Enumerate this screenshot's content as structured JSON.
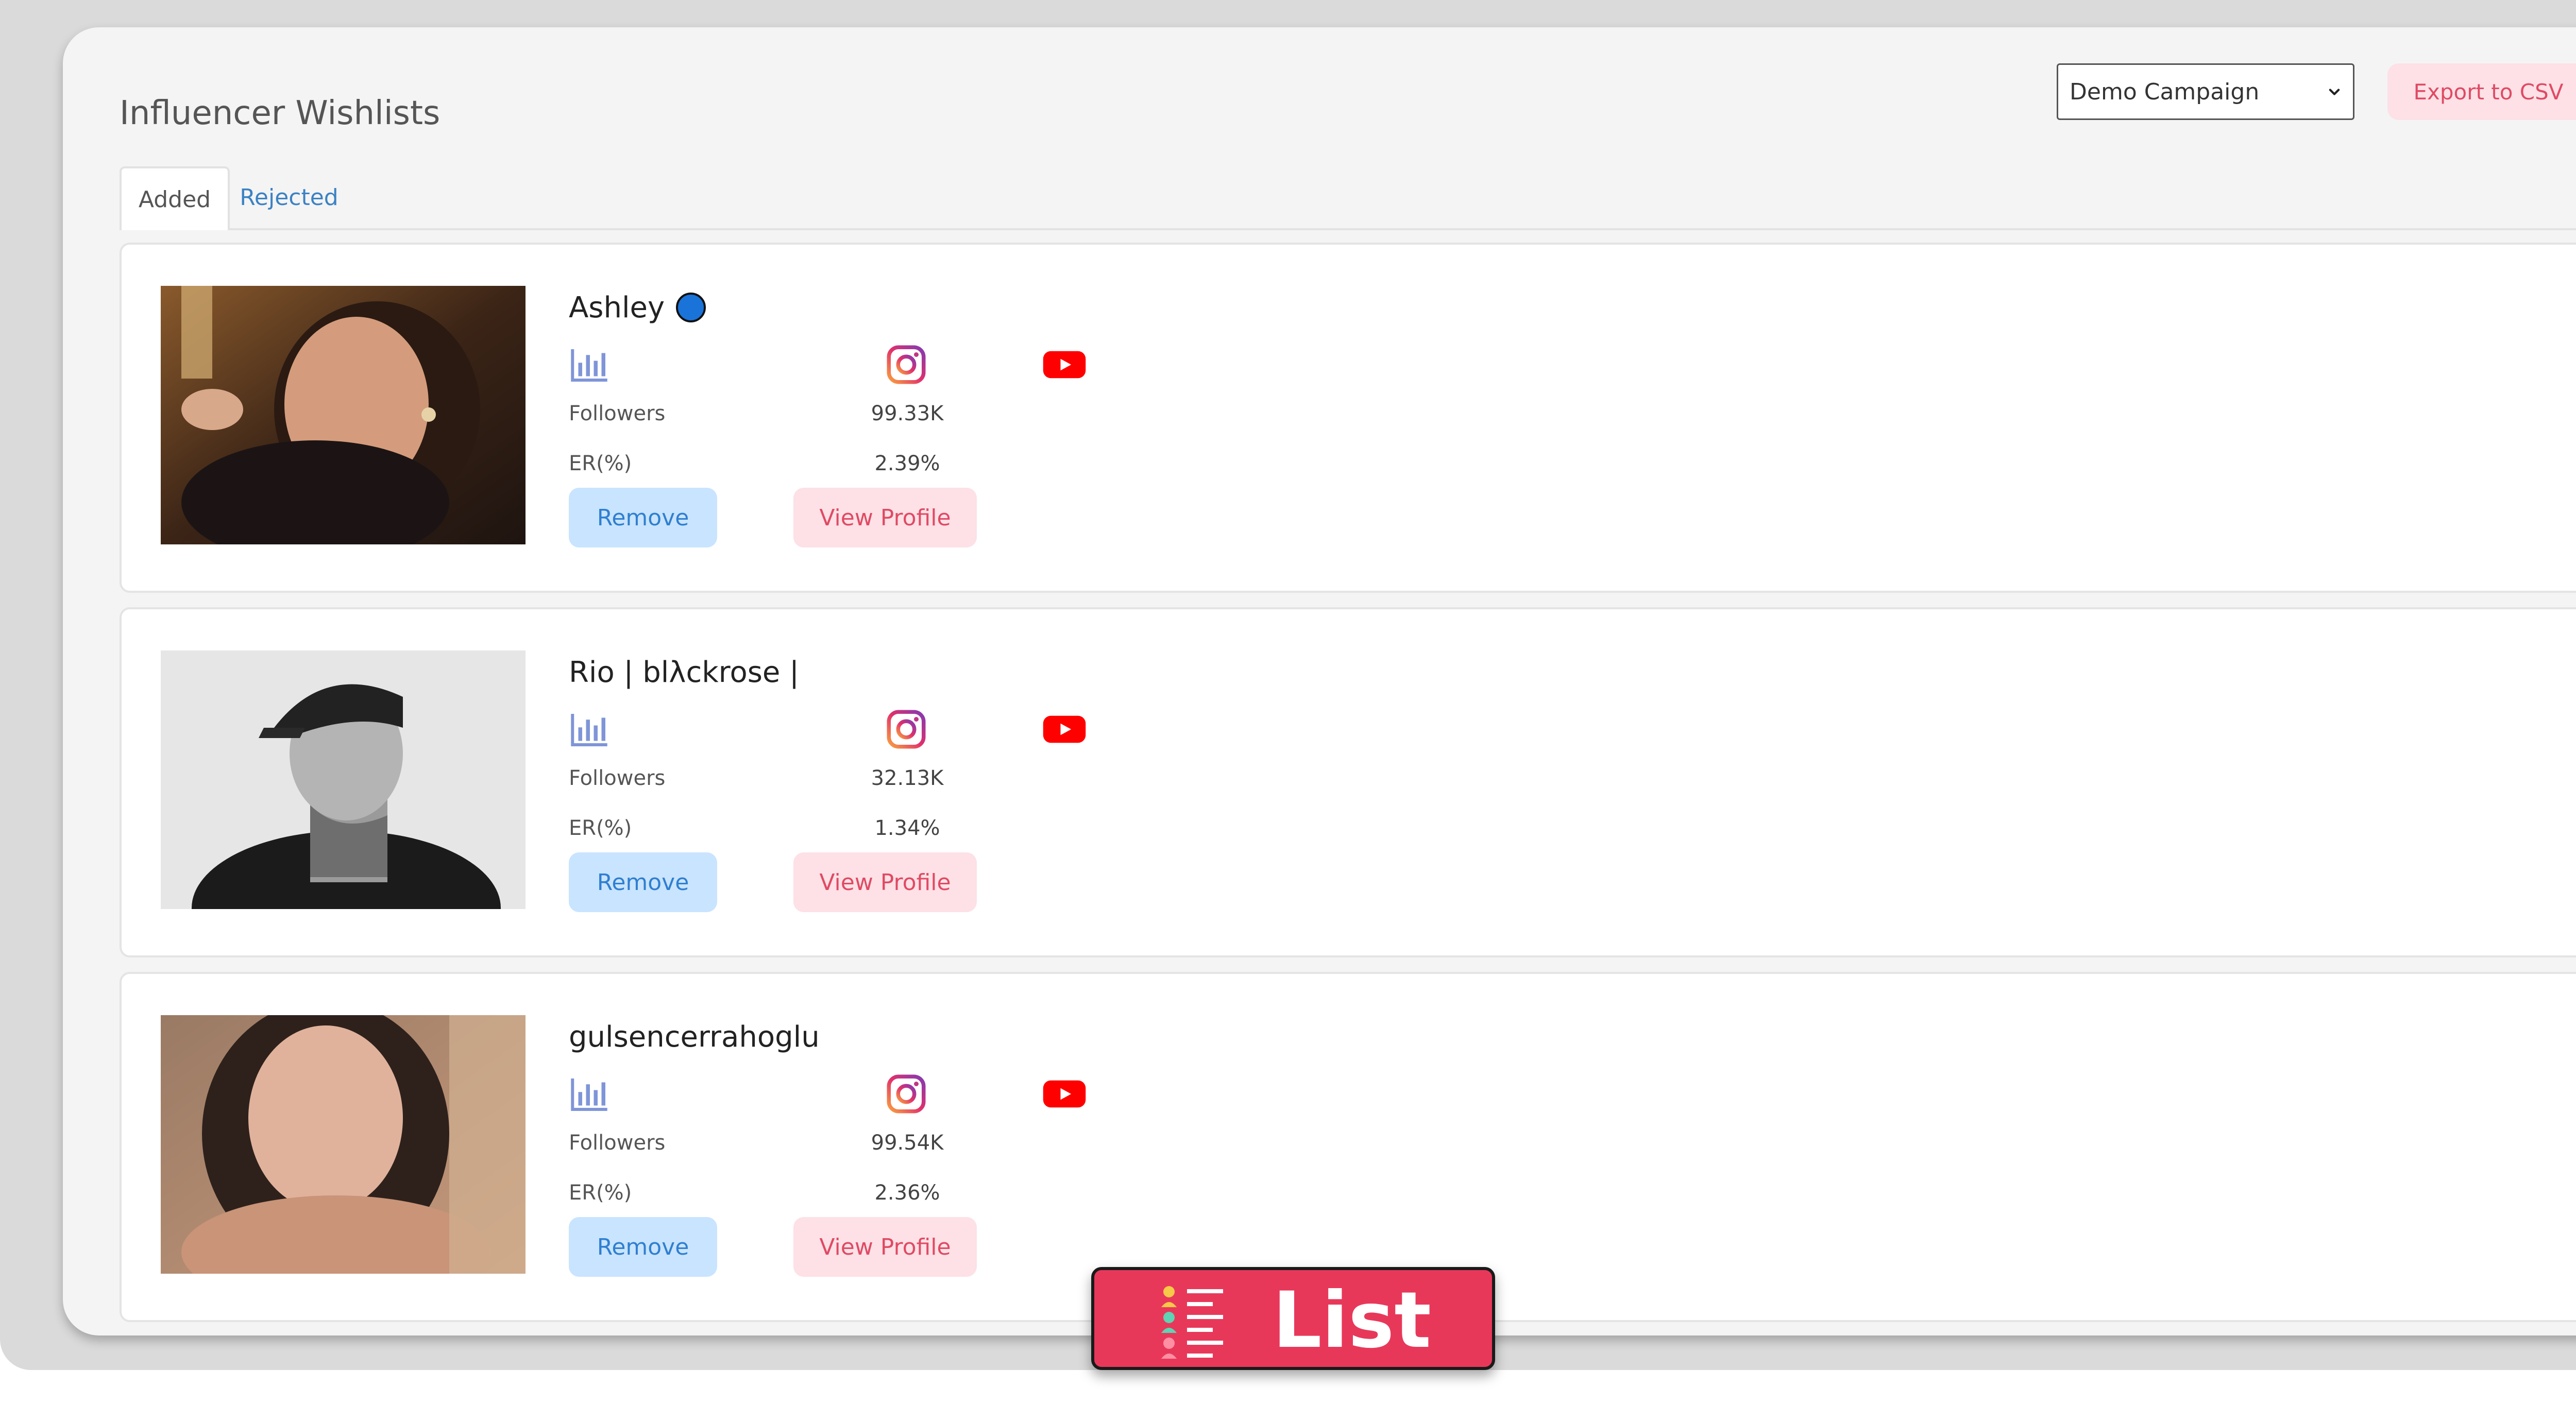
{
  "header": {
    "title": "Influencer Wishlists",
    "campaign_select": {
      "selected": "Demo Campaign"
    },
    "export_label": "Export to CSV"
  },
  "tabs": [
    {
      "label": "Added",
      "active": true
    },
    {
      "label": "Rejected",
      "active": false
    }
  ],
  "influencers": [
    {
      "name": "Ashley",
      "verified": true,
      "followers_label": "Followers",
      "followers": "99.33K",
      "er_label": "ER(%)",
      "er": "2.39%",
      "remove_label": "Remove",
      "view_label": "View Profile"
    },
    {
      "name": "Rio | blλckrose |",
      "verified": false,
      "followers_label": "Followers",
      "followers": "32.13K",
      "er_label": "ER(%)",
      "er": "1.34%",
      "remove_label": "Remove",
      "view_label": "View Profile"
    },
    {
      "name": "gulsencerrahoglu",
      "verified": false,
      "followers_label": "Followers",
      "followers": "99.54K",
      "er_label": "ER(%)",
      "er": "2.36%",
      "remove_label": "Remove",
      "view_label": "View Profile"
    }
  ],
  "icons": {
    "stats": "bar-chart-icon",
    "instagram": "instagram-icon",
    "youtube": "youtube-icon",
    "list": "list-icon"
  },
  "overlay": {
    "label": "List"
  },
  "colors": {
    "accent_pink": "#e8385a",
    "remove_bg": "#c9e4ff",
    "view_bg": "#fde1e6",
    "verified_blue": "#1a73d9",
    "youtube_red": "#ff0000"
  }
}
